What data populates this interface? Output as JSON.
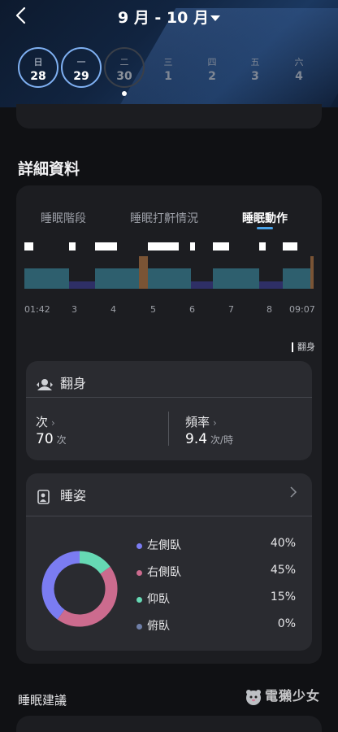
{
  "header": {
    "range_title": "9 月 - 10 月",
    "days": [
      {
        "weekday": "日",
        "date": "28",
        "state": "selected"
      },
      {
        "weekday": "一",
        "date": "29",
        "state": "selected"
      },
      {
        "weekday": "二",
        "date": "30",
        "state": "current"
      },
      {
        "weekday": "三",
        "date": "1",
        "state": "future"
      },
      {
        "weekday": "四",
        "date": "2",
        "state": "future"
      },
      {
        "weekday": "五",
        "date": "3",
        "state": "future"
      },
      {
        "weekday": "六",
        "date": "4",
        "state": "future"
      }
    ]
  },
  "details": {
    "section_title": "詳細資料",
    "tabs": [
      {
        "label": "睡眠階段",
        "active": false
      },
      {
        "label": "睡眠打鼾情況",
        "active": false
      },
      {
        "label": "睡眠動作",
        "active": true
      }
    ],
    "time_labels": [
      "01:42",
      "3",
      "4",
      "5",
      "6",
      "7",
      "8",
      "09:07"
    ],
    "legend_label": "翻身",
    "colors": {
      "stage_light": "#2e5f6e",
      "stage_deep": "#2e2f66",
      "stage_awake": "#7a5435",
      "movement": "#ffffff",
      "accent": "#4aa3e8"
    }
  },
  "turnover": {
    "title": "翻身",
    "count_label": "次",
    "count_value": "70",
    "count_unit": "次",
    "rate_label": "頻率",
    "rate_value": "9.4",
    "rate_unit": "次/時"
  },
  "posture": {
    "title": "睡姿",
    "items": [
      {
        "label": "左側臥",
        "pct": "40%",
        "value": 40,
        "color": "#7b7cf2"
      },
      {
        "label": "右側臥",
        "pct": "45%",
        "value": 45,
        "color": "#cc6b8e"
      },
      {
        "label": "仰臥",
        "pct": "15%",
        "value": 15,
        "color": "#66d9b4"
      },
      {
        "label": "俯臥",
        "pct": "0%",
        "value": 0,
        "color": "#6f7fa8"
      }
    ]
  },
  "advice": {
    "title": "睡眠建議"
  },
  "watermark": {
    "text": "電獺少女"
  }
}
